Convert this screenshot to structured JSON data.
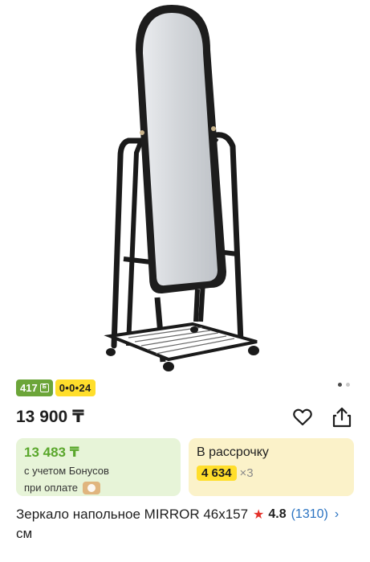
{
  "gallery": {
    "image_alt": "Зеркало напольное MIRROR",
    "pager": {
      "total": 2,
      "active": 1
    }
  },
  "badges": {
    "bonus": "417",
    "installment": "0•0•24"
  },
  "price": "13 900 ₸",
  "bonus_card": {
    "price": "13 483 ₸",
    "line1": "с учетом Бонусов",
    "line2": "при оплате"
  },
  "install_card": {
    "title": "В рассрочку",
    "amount": "4 634",
    "multiplier": "×3"
  },
  "product": {
    "title": "Зеркало напольное MIRROR 46x157 см"
  },
  "rating": {
    "value": "4.8",
    "count": "(1310)"
  },
  "colors": {
    "bonus_green": "#6ca539",
    "installment_yellow": "#ffde2b",
    "star_red": "#e4322b",
    "link_blue": "#2a73c2"
  },
  "icons": [
    "heart-icon",
    "share-icon",
    "star-icon",
    "chevron-right-icon",
    "bonus-coin-icon"
  ]
}
